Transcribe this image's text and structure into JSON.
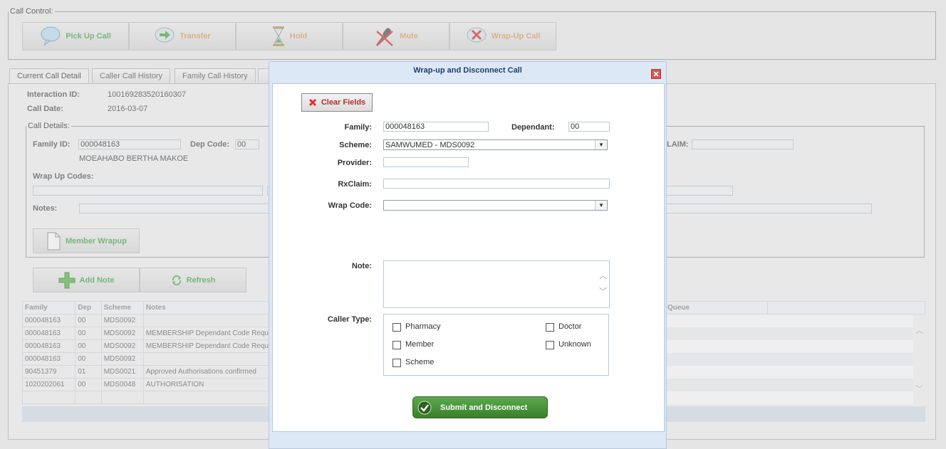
{
  "call_control": {
    "legend": "Call Control:",
    "buttons": {
      "pickup": "Pick Up Call",
      "transfer": "Transfer",
      "hold": "Hold",
      "mute": "Mute",
      "wrapup": "Wrap-Up Call"
    }
  },
  "tabs": [
    "Current Call Detail",
    "Caller Call History",
    "Family Call History"
  ],
  "detail": {
    "interaction_id_label": "Interaction ID:",
    "interaction_id": "100169283520160307",
    "call_date_label": "Call Date:",
    "call_date": "2016-03-07",
    "call_details_legend": "Call Details:",
    "family_id_label": "Family ID:",
    "family_id": "000048163",
    "dep_code_label": "Dep Code:",
    "dep_code": "00",
    "member_name": "MOEAHABO BERTHA MAKOE",
    "claim_label": "LAIM:",
    "wrap_up_codes_label": "Wrap Up Codes:",
    "notes_label": "Notes:",
    "member_wrapup_button": "Member Wrapup"
  },
  "actions": {
    "add_note": "Add Note",
    "refresh": "Refresh"
  },
  "grid": {
    "headers": [
      "Family",
      "Dep",
      "Scheme",
      "Notes"
    ],
    "queue_header": "Queue",
    "rows": [
      [
        "000048163",
        "00",
        "MDS0092",
        ""
      ],
      [
        "000048163",
        "00",
        "MDS0092",
        "MEMBERSHIP Dependant Code Requ"
      ],
      [
        "000048163",
        "00",
        "MDS0092",
        "MEMBERSHIP Dependant Code Requ"
      ],
      [
        "000048163",
        "00",
        "MDS0092",
        ""
      ],
      [
        "90451379",
        "01",
        "MDS0021",
        "Approved Authorisations confirmed"
      ],
      [
        "1020202061",
        "00",
        "MDS0048",
        "AUTHORISATION"
      ]
    ]
  },
  "dialog": {
    "title": "Wrap-up and Disconnect Call",
    "clear_fields": "Clear Fields",
    "family_label": "Family:",
    "family_value": "000048163",
    "dependant_label": "Dependant:",
    "dependant_value": "00",
    "scheme_label": "Scheme:",
    "scheme_value": "SAMWUMED - MDS0092",
    "provider_label": "Provider:",
    "rxclaim_label": "RxClaim:",
    "wrap_code_label": "Wrap Code:",
    "note_label": "Note:",
    "caller_type_label": "Caller Type:",
    "caller_types": {
      "pharmacy": "Pharmacy",
      "doctor": "Doctor",
      "member": "Member",
      "unknown": "Unknown",
      "scheme": "Scheme"
    },
    "submit": "Submit and Disconnect"
  },
  "colors": {
    "accent_green": "#4aa84a",
    "disabled_orange": "#d9a36a",
    "dialog_title": "#1d3f6e",
    "submit_bg": "#3f8c32",
    "close_red": "#c0392b"
  }
}
